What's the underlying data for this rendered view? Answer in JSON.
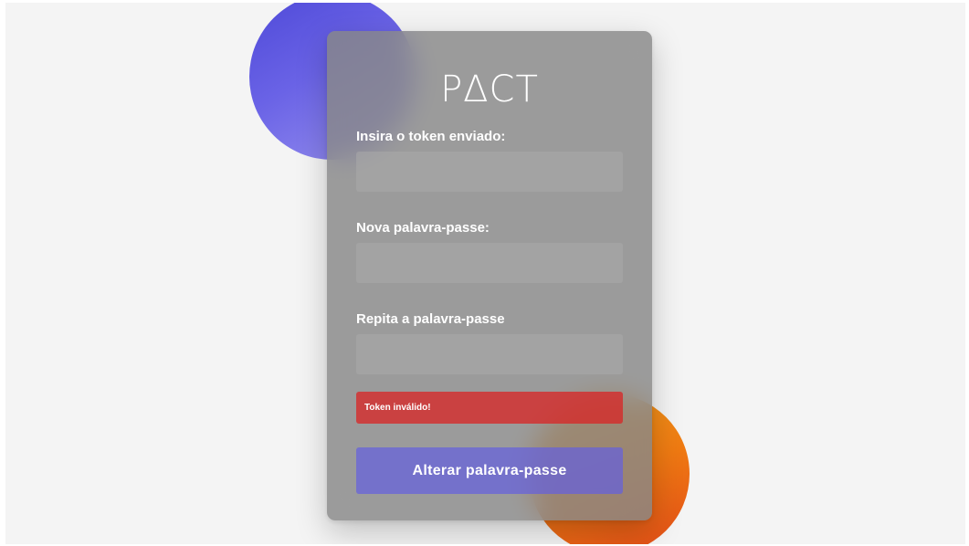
{
  "app": {
    "logo_text": "PΔCT"
  },
  "form": {
    "token": {
      "label": "Insira o token enviado:",
      "value": "",
      "placeholder": ""
    },
    "new_password": {
      "label": "Nova palavra-passe:",
      "value": "",
      "placeholder": ""
    },
    "repeat_password": {
      "label": "Repita a palavra-passe",
      "value": "",
      "placeholder": ""
    },
    "error_message": "Token inválido!",
    "submit_label": "Alterar palavra-passe"
  },
  "colors": {
    "background": "#f4f4f4",
    "card": "#878787",
    "accent_blue": "#5a55de",
    "accent_orange": "#ef7a12",
    "error": "#d72828",
    "button": "#645fdc"
  }
}
